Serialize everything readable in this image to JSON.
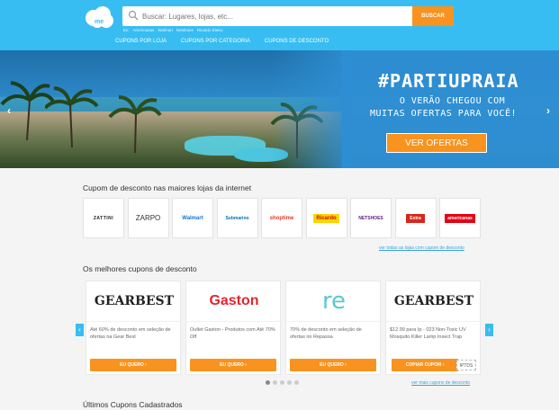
{
  "header": {
    "logo_alt": "Cuponation",
    "search_placeholder": "Buscar: Lugares, lojas, etc...",
    "search_button": "BUSCAR",
    "hints": [
      "Ex:",
      "Americanas",
      "Walmart",
      "Netshoes",
      "Ricardo Eletro"
    ],
    "nav": [
      "CUPONS POR LOJA",
      "CUPONS POR CATEGORIA",
      "CUPONS DE DESCONTO"
    ]
  },
  "banner": {
    "hashtag": "#PARTIUPRAIA",
    "line1": "O VERÃO CHEGOU COM",
    "line2": "MUITAS OFERTAS PARA VOCÊ!",
    "cta": "VER OFERTAS",
    "prev": "‹",
    "next": "›"
  },
  "stores_section": {
    "title": "Cupom de desconto nas maiores lojas da internet",
    "stores": [
      "ZATTINI",
      "ZARPO",
      "Walmart",
      "Submarino",
      "shoptime",
      "Ricardo",
      "NETSHOES",
      "Extra",
      "americanas"
    ],
    "see_all": "ver todas as lojas com cupom de desconto"
  },
  "coupons_section": {
    "title": "Os melhores cupons de desconto",
    "coupons": [
      {
        "brand": "GEARBEST",
        "desc": "Até 60% de desconto em seleção de ofertas na Gear Best",
        "button": "EU QUERO ›"
      },
      {
        "brand": "Gaston",
        "desc": "Outlet Gaston - Produtos com Até 70% Off",
        "button": "EU QUERO ›"
      },
      {
        "brand": "re",
        "desc": "70% de desconto em seleção de ofertas no Repassa",
        "button": "EU QUERO ›"
      },
      {
        "brand": "GEARBEST",
        "desc": "$12.99 para Ip - 023 Non-Toxic UV Mosquito Killer Lamp Insect Trap",
        "button": "COPIAR CUPOM ›",
        "code": "IPTDS"
      }
    ],
    "prev": "‹",
    "next": "›",
    "see_more": "ver mais cupons de desconto"
  },
  "latest_section": {
    "title": "Últimos Cupons Cadastrados"
  },
  "colors": {
    "header": "#38bdf2",
    "accent": "#f7931e",
    "link": "#38a3e0"
  }
}
